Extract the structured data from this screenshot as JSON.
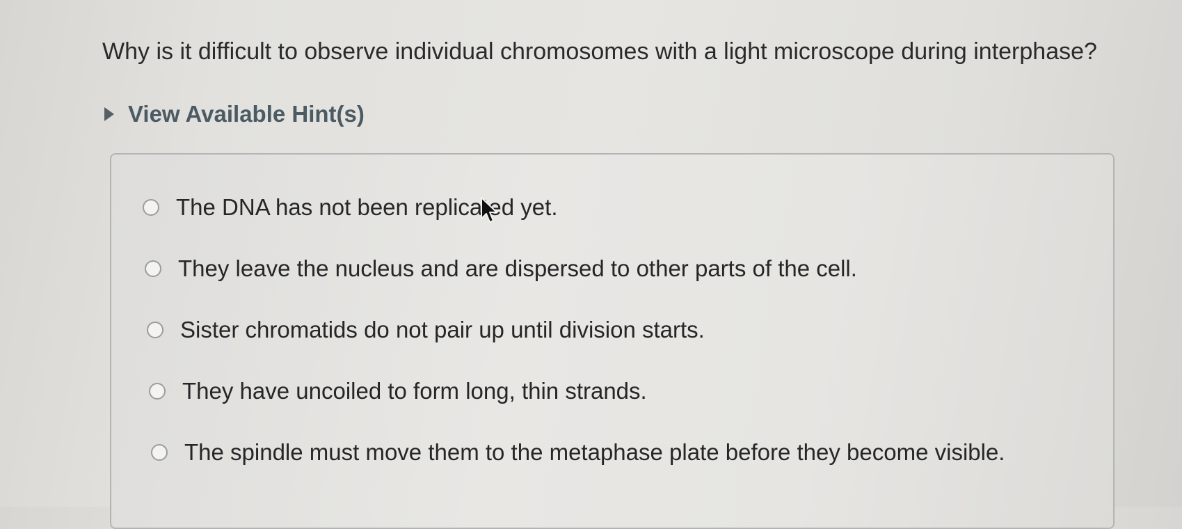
{
  "question": {
    "text": "Why is it difficult to observe individual chromosomes with a light microscope during interphase?"
  },
  "hints": {
    "label": "View Available Hint(s)",
    "icon": "caret-right-icon"
  },
  "answer_options": [
    {
      "text": "The DNA has not been replicated yet."
    },
    {
      "text": "They leave the nucleus and are dispersed to other parts of the cell."
    },
    {
      "text": "Sister chromatids do not pair up until division starts."
    },
    {
      "text": "They have uncoiled to form long, thin strands."
    },
    {
      "text": "The spindle must move them to the metaphase plate before they become visible."
    }
  ],
  "colors": {
    "hint_text": "#4b5a63",
    "body_text": "#262626",
    "box_border": "#b4b4b2"
  }
}
